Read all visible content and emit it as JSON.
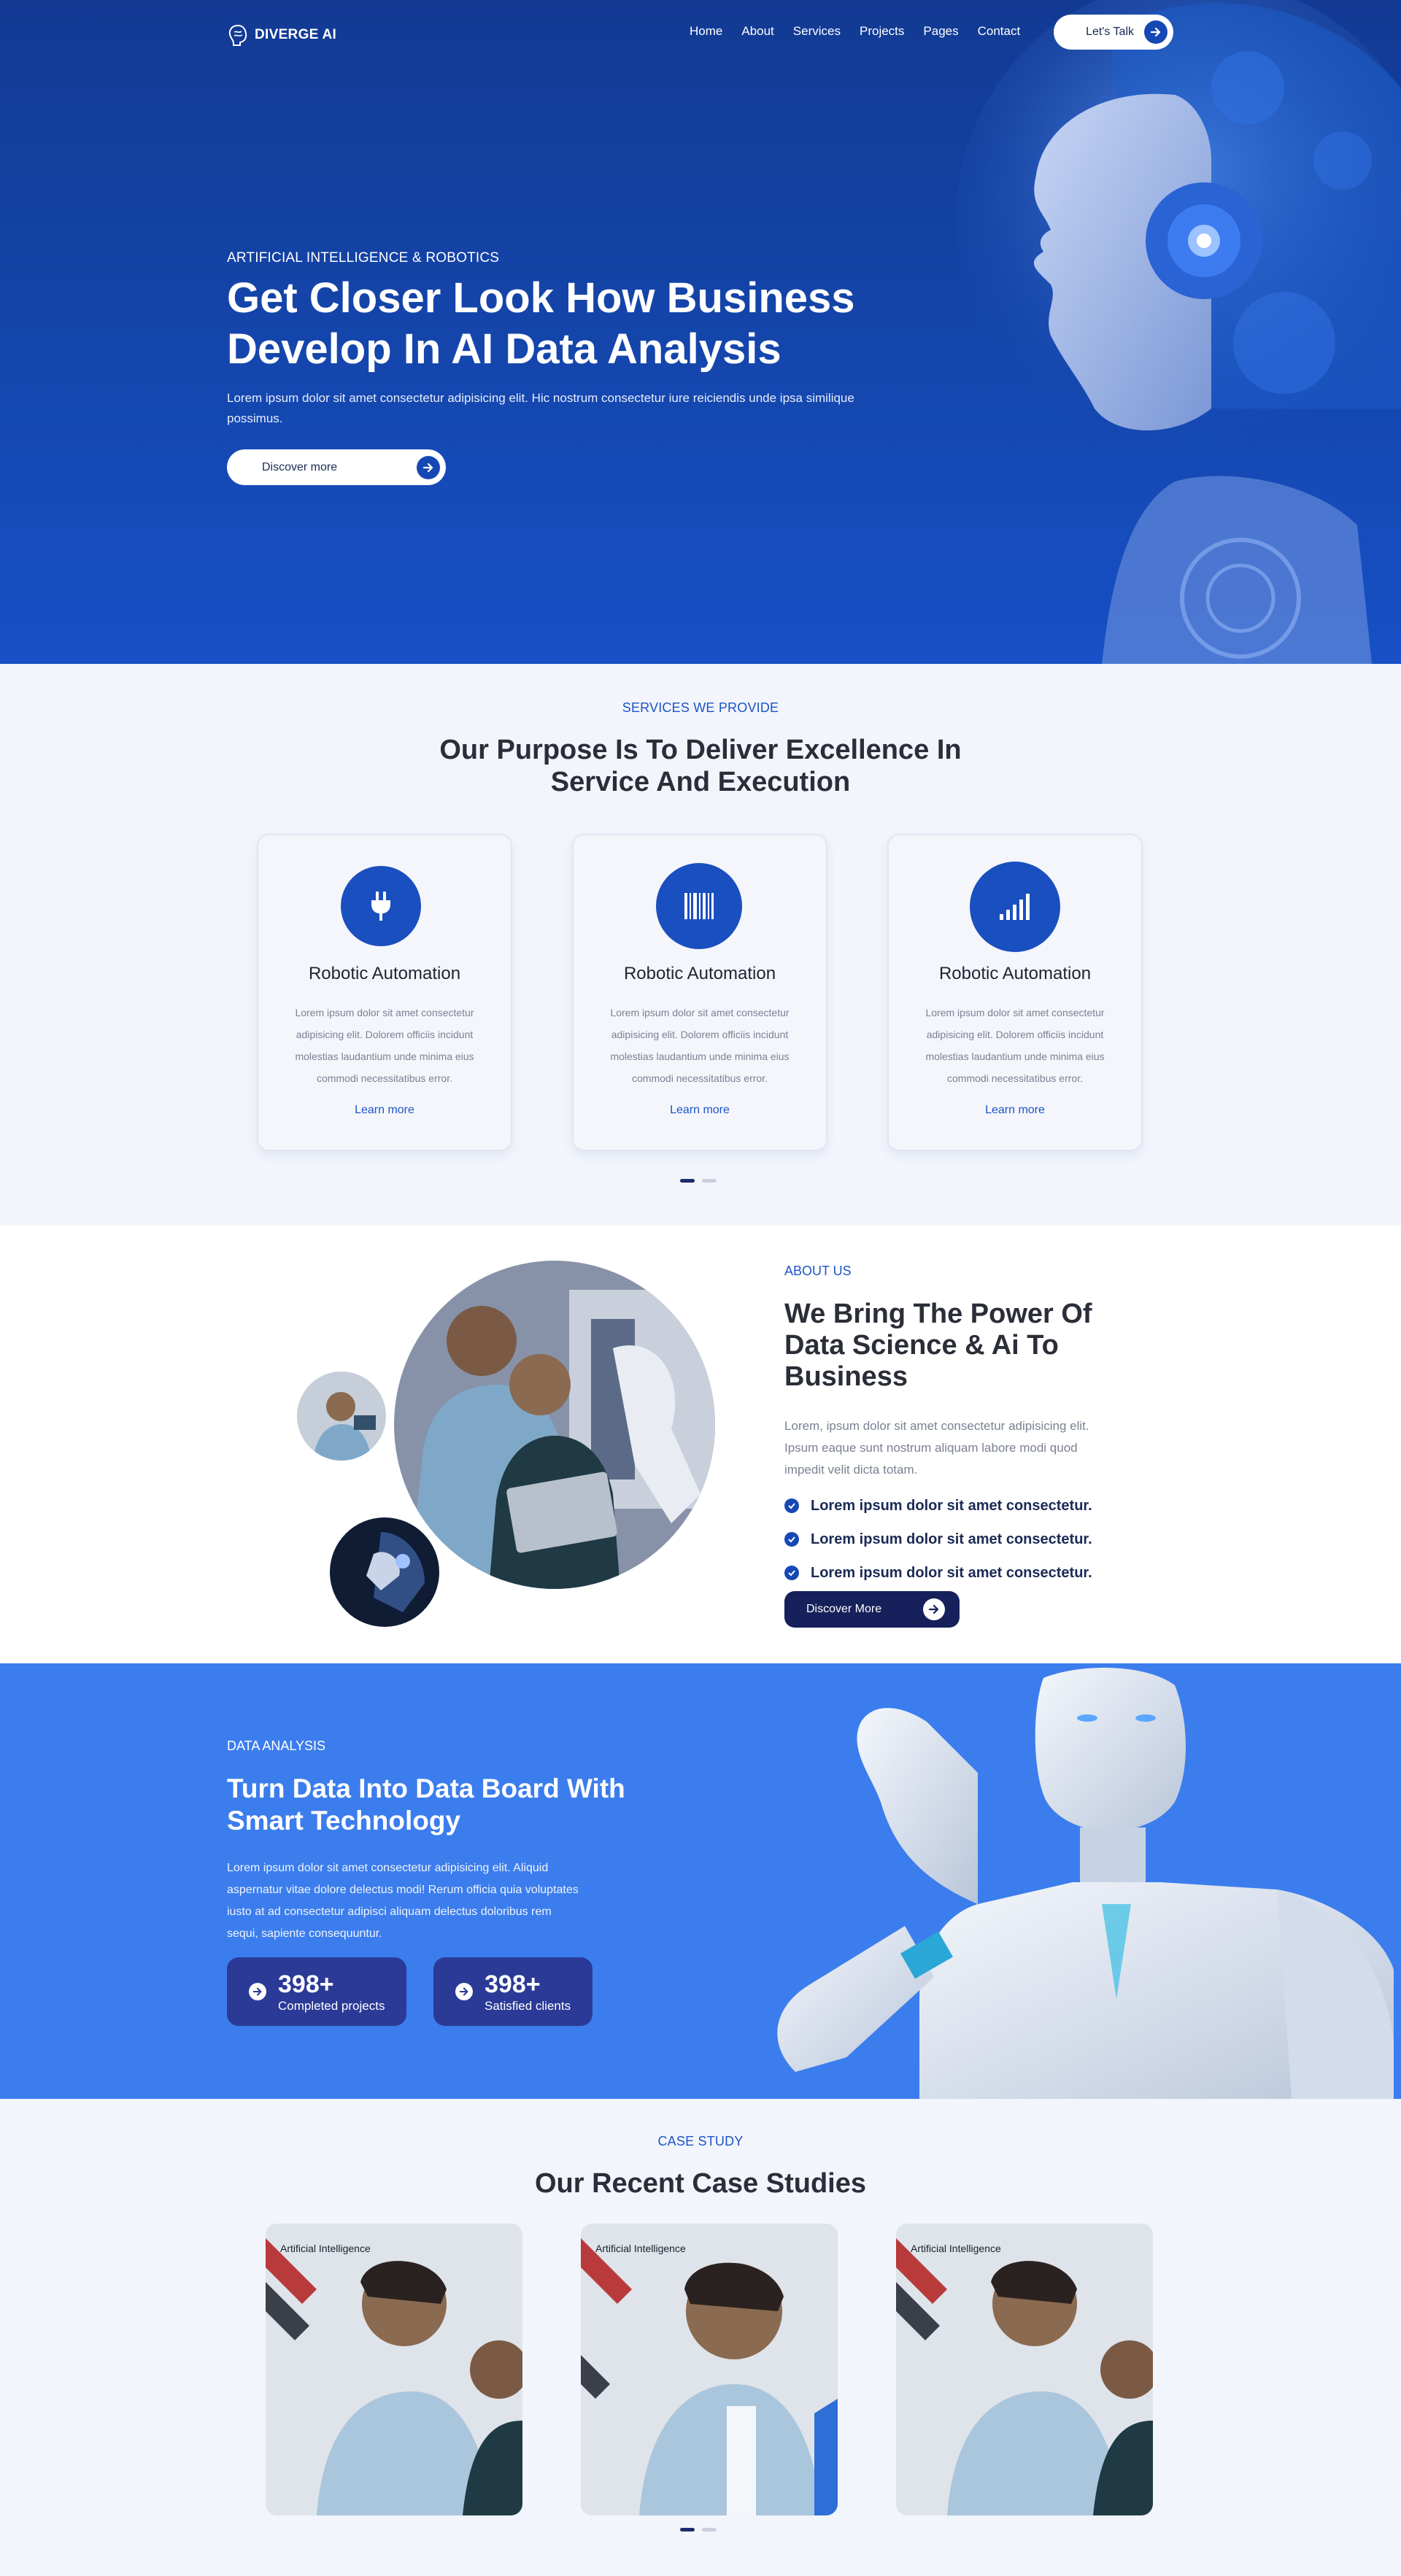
{
  "brand": {
    "name": "DIVERGE AI",
    "accent": "#1648b5",
    "dark": "#16205a",
    "light_blue": "#3b7ded"
  },
  "nav": {
    "links": [
      "Home",
      "About",
      "Services",
      "Projects",
      "Pages",
      "Contact"
    ],
    "cta": "Let's Talk"
  },
  "hero": {
    "eyebrow": "ARTIFICIAL INTELLIGENCE & ROBOTICS",
    "title": "Get Closer Look How Business Develop In AI Data Analysis",
    "description": "Lorem ipsum dolor sit amet consectetur adipisicing elit. Hic nostrum consectetur iure reiciendis unde ipsa similique possimus.",
    "button": "Discover more"
  },
  "services": {
    "eyebrow": "SERVICES WE PROVIDE",
    "title": "Our Purpose Is To Deliver Excellence In Service And Execution",
    "cards": [
      {
        "icon": "plug-icon",
        "title": "Robotic Automation",
        "text": "Lorem ipsum dolor sit amet consectetur adipisicing elit. Dolorem officiis incidunt molestias laudantium unde minima eius commodi necessitatibus error.",
        "link": "Learn more"
      },
      {
        "icon": "barcode-icon",
        "title": "Robotic Automation",
        "text": "Lorem ipsum dolor sit amet consectetur adipisicing elit. Dolorem officiis incidunt molestias laudantium unde minima eius commodi necessitatibus error.",
        "link": "Learn more"
      },
      {
        "icon": "signal-bars-icon",
        "title": "Robotic Automation",
        "text": "Lorem ipsum dolor sit amet consectetur adipisicing elit. Dolorem officiis incidunt molestias laudantium unde minima eius commodi necessitatibus error.",
        "link": "Learn more"
      }
    ]
  },
  "about": {
    "eyebrow": "ABOUT US",
    "title": "We Bring The Power Of Data Science & Ai To Business",
    "description": "Lorem, ipsum dolor sit amet consectetur adipisicing elit. Ipsum eaque sunt nostrum aliquam labore modi quod impedit velit dicta totam.",
    "checks": [
      "Lorem ipsum dolor sit amet consectetur.",
      "Lorem ipsum dolor sit amet consectetur.",
      "Lorem ipsum dolor sit amet consectetur."
    ],
    "button": "Discover More"
  },
  "data_section": {
    "eyebrow": "DATA ANALYSIS",
    "title": "Turn Data Into Data Board With Smart Technology",
    "description": "Lorem ipsum dolor sit amet consectetur adipisicing elit. Aliquid aspernatur vitae dolore delectus modi! Rerum officia quia voluptates iusto at ad consectetur adipisci aliquam delectus doloribus rem sequi, sapiente consequuntur.",
    "stats": [
      {
        "value": "398+",
        "label": "Completed projects"
      },
      {
        "value": "398+",
        "label": "Satisfied clients"
      }
    ]
  },
  "cases": {
    "eyebrow": "CASE STUDY",
    "title": "Our Recent Case Studies",
    "items": [
      {
        "label": "Artificial Intelligence"
      },
      {
        "label": "Artificial Intelligence"
      },
      {
        "label": "Artificial Intelligence"
      }
    ]
  }
}
